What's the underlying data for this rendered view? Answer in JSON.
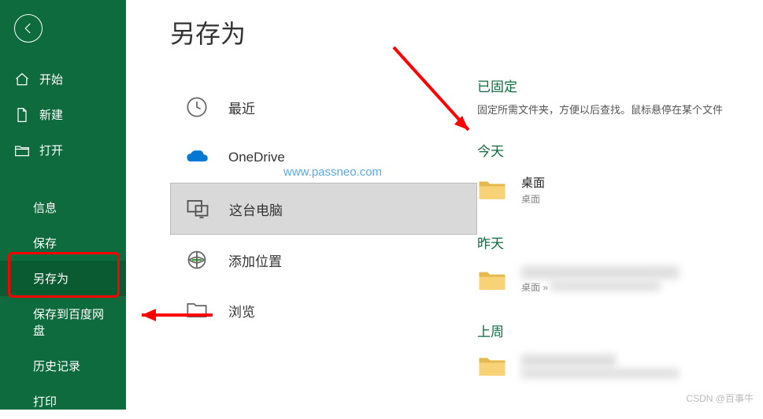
{
  "page_title": "另存为",
  "sidebar": {
    "items": [
      {
        "label": "开始"
      },
      {
        "label": "新建"
      },
      {
        "label": "打开"
      },
      {
        "label": "信息"
      },
      {
        "label": "保存"
      },
      {
        "label": "另存为"
      },
      {
        "label": "保存到百度网盘"
      },
      {
        "label": "历史记录"
      },
      {
        "label": "打印"
      }
    ]
  },
  "locations": {
    "recent": "最近",
    "onedrive": "OneDrive",
    "this_pc": "这台电脑",
    "add_place": "添加位置",
    "browse": "浏览"
  },
  "right": {
    "pinned_title": "已固定",
    "pinned_sub": "固定所需文件夹，方便以后查找。鼠标悬停在某个文件",
    "today": "今天",
    "yesterday": "昨天",
    "last_week": "上周",
    "folder1_name": "桌面",
    "folder1_path": "桌面",
    "folder2_path_prefix": "桌面 »"
  },
  "watermark1": "www.passneo.com",
  "watermark2": "CSDN @百事牛"
}
